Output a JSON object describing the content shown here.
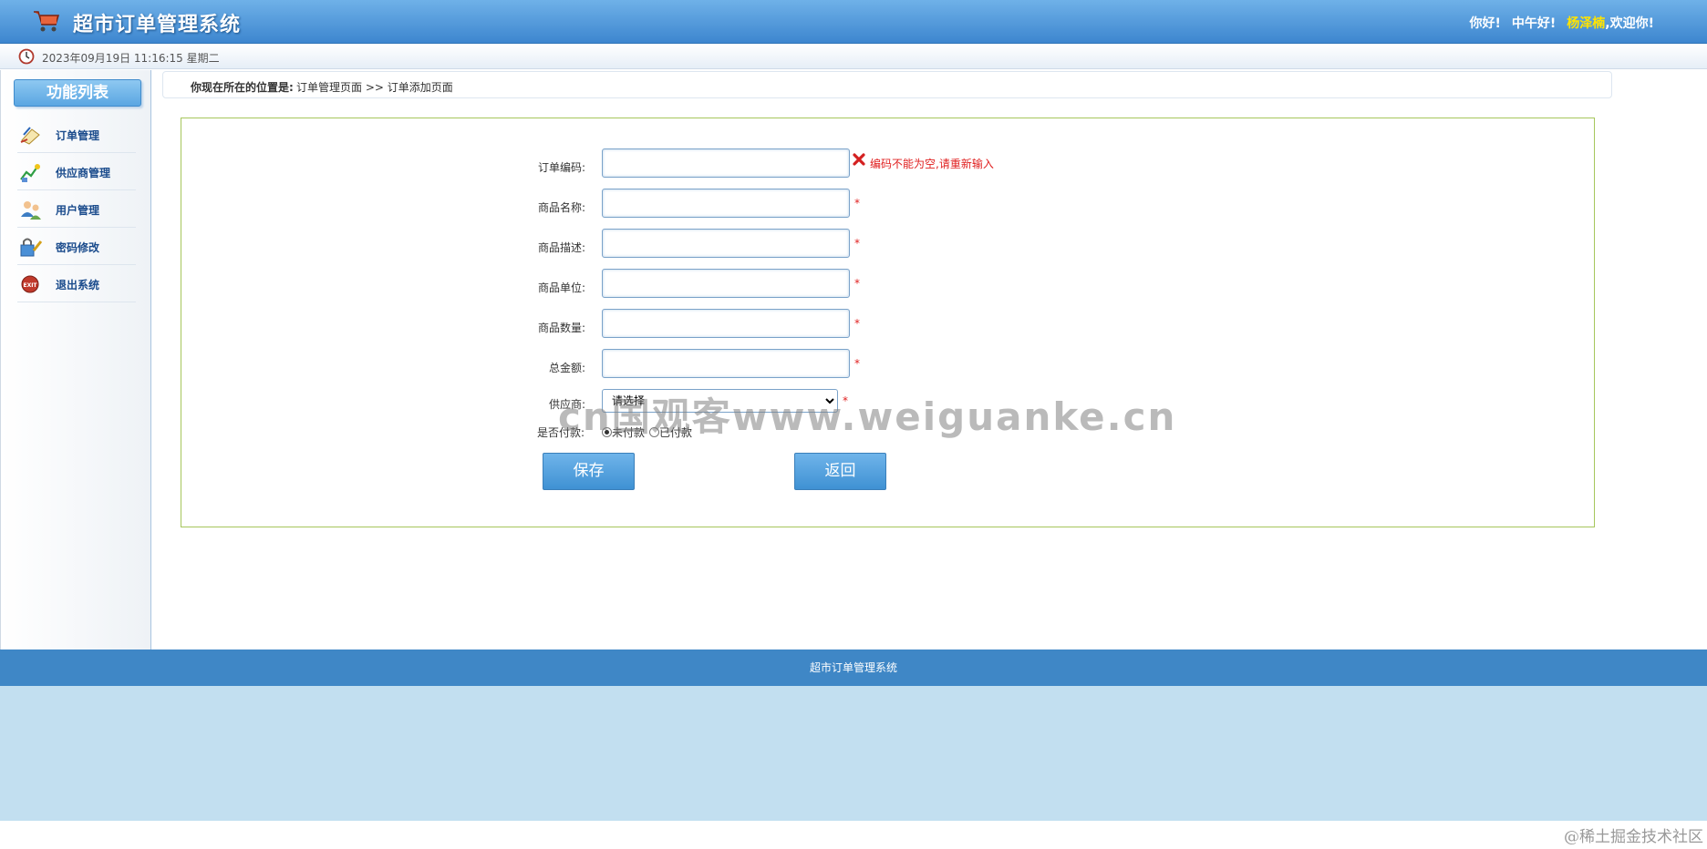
{
  "header": {
    "title": "超市订单管理系统",
    "greeting_hello": "你好!",
    "greeting_noon": "中午好!",
    "username": "杨泽楠",
    "welcome": ",欢迎你!"
  },
  "datebar": {
    "datetime": "2023年09月19日 11:16:15 星期二"
  },
  "sidebar": {
    "title": "功能列表",
    "items": [
      {
        "label": "订单管理",
        "icon": "order-icon"
      },
      {
        "label": "供应商管理",
        "icon": "supplier-icon"
      },
      {
        "label": "用户管理",
        "icon": "users-icon"
      },
      {
        "label": "密码修改",
        "icon": "lock-key-icon"
      },
      {
        "label": "退出系统",
        "icon": "exit-icon"
      }
    ]
  },
  "breadcrumb": {
    "label": "你现在所在的位置是:",
    "path": "订单管理页面 >> 订单添加页面"
  },
  "form": {
    "fields": [
      {
        "label": "订单编码:",
        "value": "",
        "error": "编码不能为空,请重新输入"
      },
      {
        "label": "商品名称:",
        "value": "",
        "star": "*"
      },
      {
        "label": "商品描述:",
        "value": "",
        "star": "*"
      },
      {
        "label": "商品单位:",
        "value": "",
        "star": "*"
      },
      {
        "label": "商品数量:",
        "value": "",
        "star": "*"
      },
      {
        "label": "总金额:",
        "value": "",
        "star": "*"
      }
    ],
    "supplier": {
      "label": "供应商:",
      "selected": "请选择",
      "star": "*"
    },
    "paid": {
      "label": "是否付款:",
      "option_unpaid": "未付款",
      "option_paid": "已付款",
      "selected": "未付款"
    },
    "save_label": "保存",
    "back_label": "返回"
  },
  "watermark": "cn国观客www.weiguanke.cn",
  "footer": {
    "text": "超市订单管理系统"
  },
  "credit": "@稀土掘金技术社区",
  "colors": {
    "header": "#4a94d8",
    "footer": "#3f87c6",
    "error": "#e02020",
    "username": "#ffe400"
  }
}
